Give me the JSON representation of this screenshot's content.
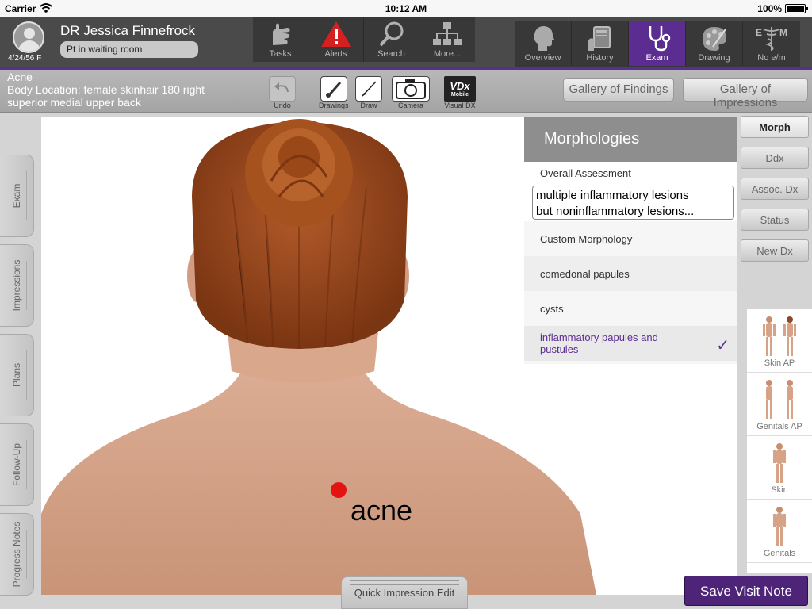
{
  "status_bar": {
    "carrier": "Carrier",
    "time": "10:12 AM",
    "battery": "100%"
  },
  "patient": {
    "dob": "4/24/56 F",
    "doctor_name": "DR Jessica  Finnefrock",
    "status": "Pt in waiting room"
  },
  "nav_tools": [
    {
      "label": "Tasks",
      "icon": "hand-icon"
    },
    {
      "label": "Alerts",
      "icon": "alert-icon"
    },
    {
      "label": "Search",
      "icon": "magnifier-icon"
    },
    {
      "label": "More...",
      "icon": "org-chart-icon"
    }
  ],
  "section_tabs": [
    {
      "label": "Overview",
      "icon": "head-profile-icon",
      "active": false
    },
    {
      "label": "History",
      "icon": "tablet-hand-icon",
      "active": false
    },
    {
      "label": "Exam",
      "icon": "stethoscope-icon",
      "active": true
    },
    {
      "label": "Drawing",
      "icon": "palette-icon",
      "active": false
    },
    {
      "label": "No e/m",
      "icon": "caduceus-icon",
      "active": false
    }
  ],
  "finding": {
    "name": "Acne",
    "location": "Body Location: female skinhair 180 right superior medial upper back"
  },
  "toolbar": {
    "undo": "Undo",
    "drawings": "Drawings",
    "draw": "Draw",
    "camera": "Camera",
    "visual_dx": "Visual DX",
    "vdx_logo": "VDx Mobile",
    "gallery_findings": "Gallery of Findings",
    "gallery_impressions": "Gallery of Impressions"
  },
  "left_tabs": [
    "Exam",
    "Impressions",
    "Plans",
    "Follow-Up",
    "Progress Notes"
  ],
  "canvas": {
    "marker_label": "acne"
  },
  "morphologies": {
    "title": "Morphologies",
    "overall_label": "Overall Assessment",
    "overall_line1": "multiple inflammatory lesions",
    "overall_line2": "but noninflammatory lesions...",
    "items": [
      {
        "label": "Custom Morphology",
        "selected": false
      },
      {
        "label": "comedonal papules",
        "selected": false
      },
      {
        "label": "cysts",
        "selected": false
      },
      {
        "label": "inflammatory papules and pustules",
        "selected": true
      }
    ]
  },
  "right_rail": {
    "buttons": [
      "Morph",
      "Ddx",
      "Assoc. Dx",
      "Status",
      "New Dx"
    ],
    "thumbnails": [
      "Skin AP",
      "Genitals AP",
      "Skin",
      "Genitals"
    ]
  },
  "footer": {
    "quick_edit": "Quick Impression Edit",
    "save": "Save Visit Note"
  },
  "colors": {
    "accent": "#5c2d91",
    "save_button": "#4d2478",
    "marker": "#e51212"
  }
}
